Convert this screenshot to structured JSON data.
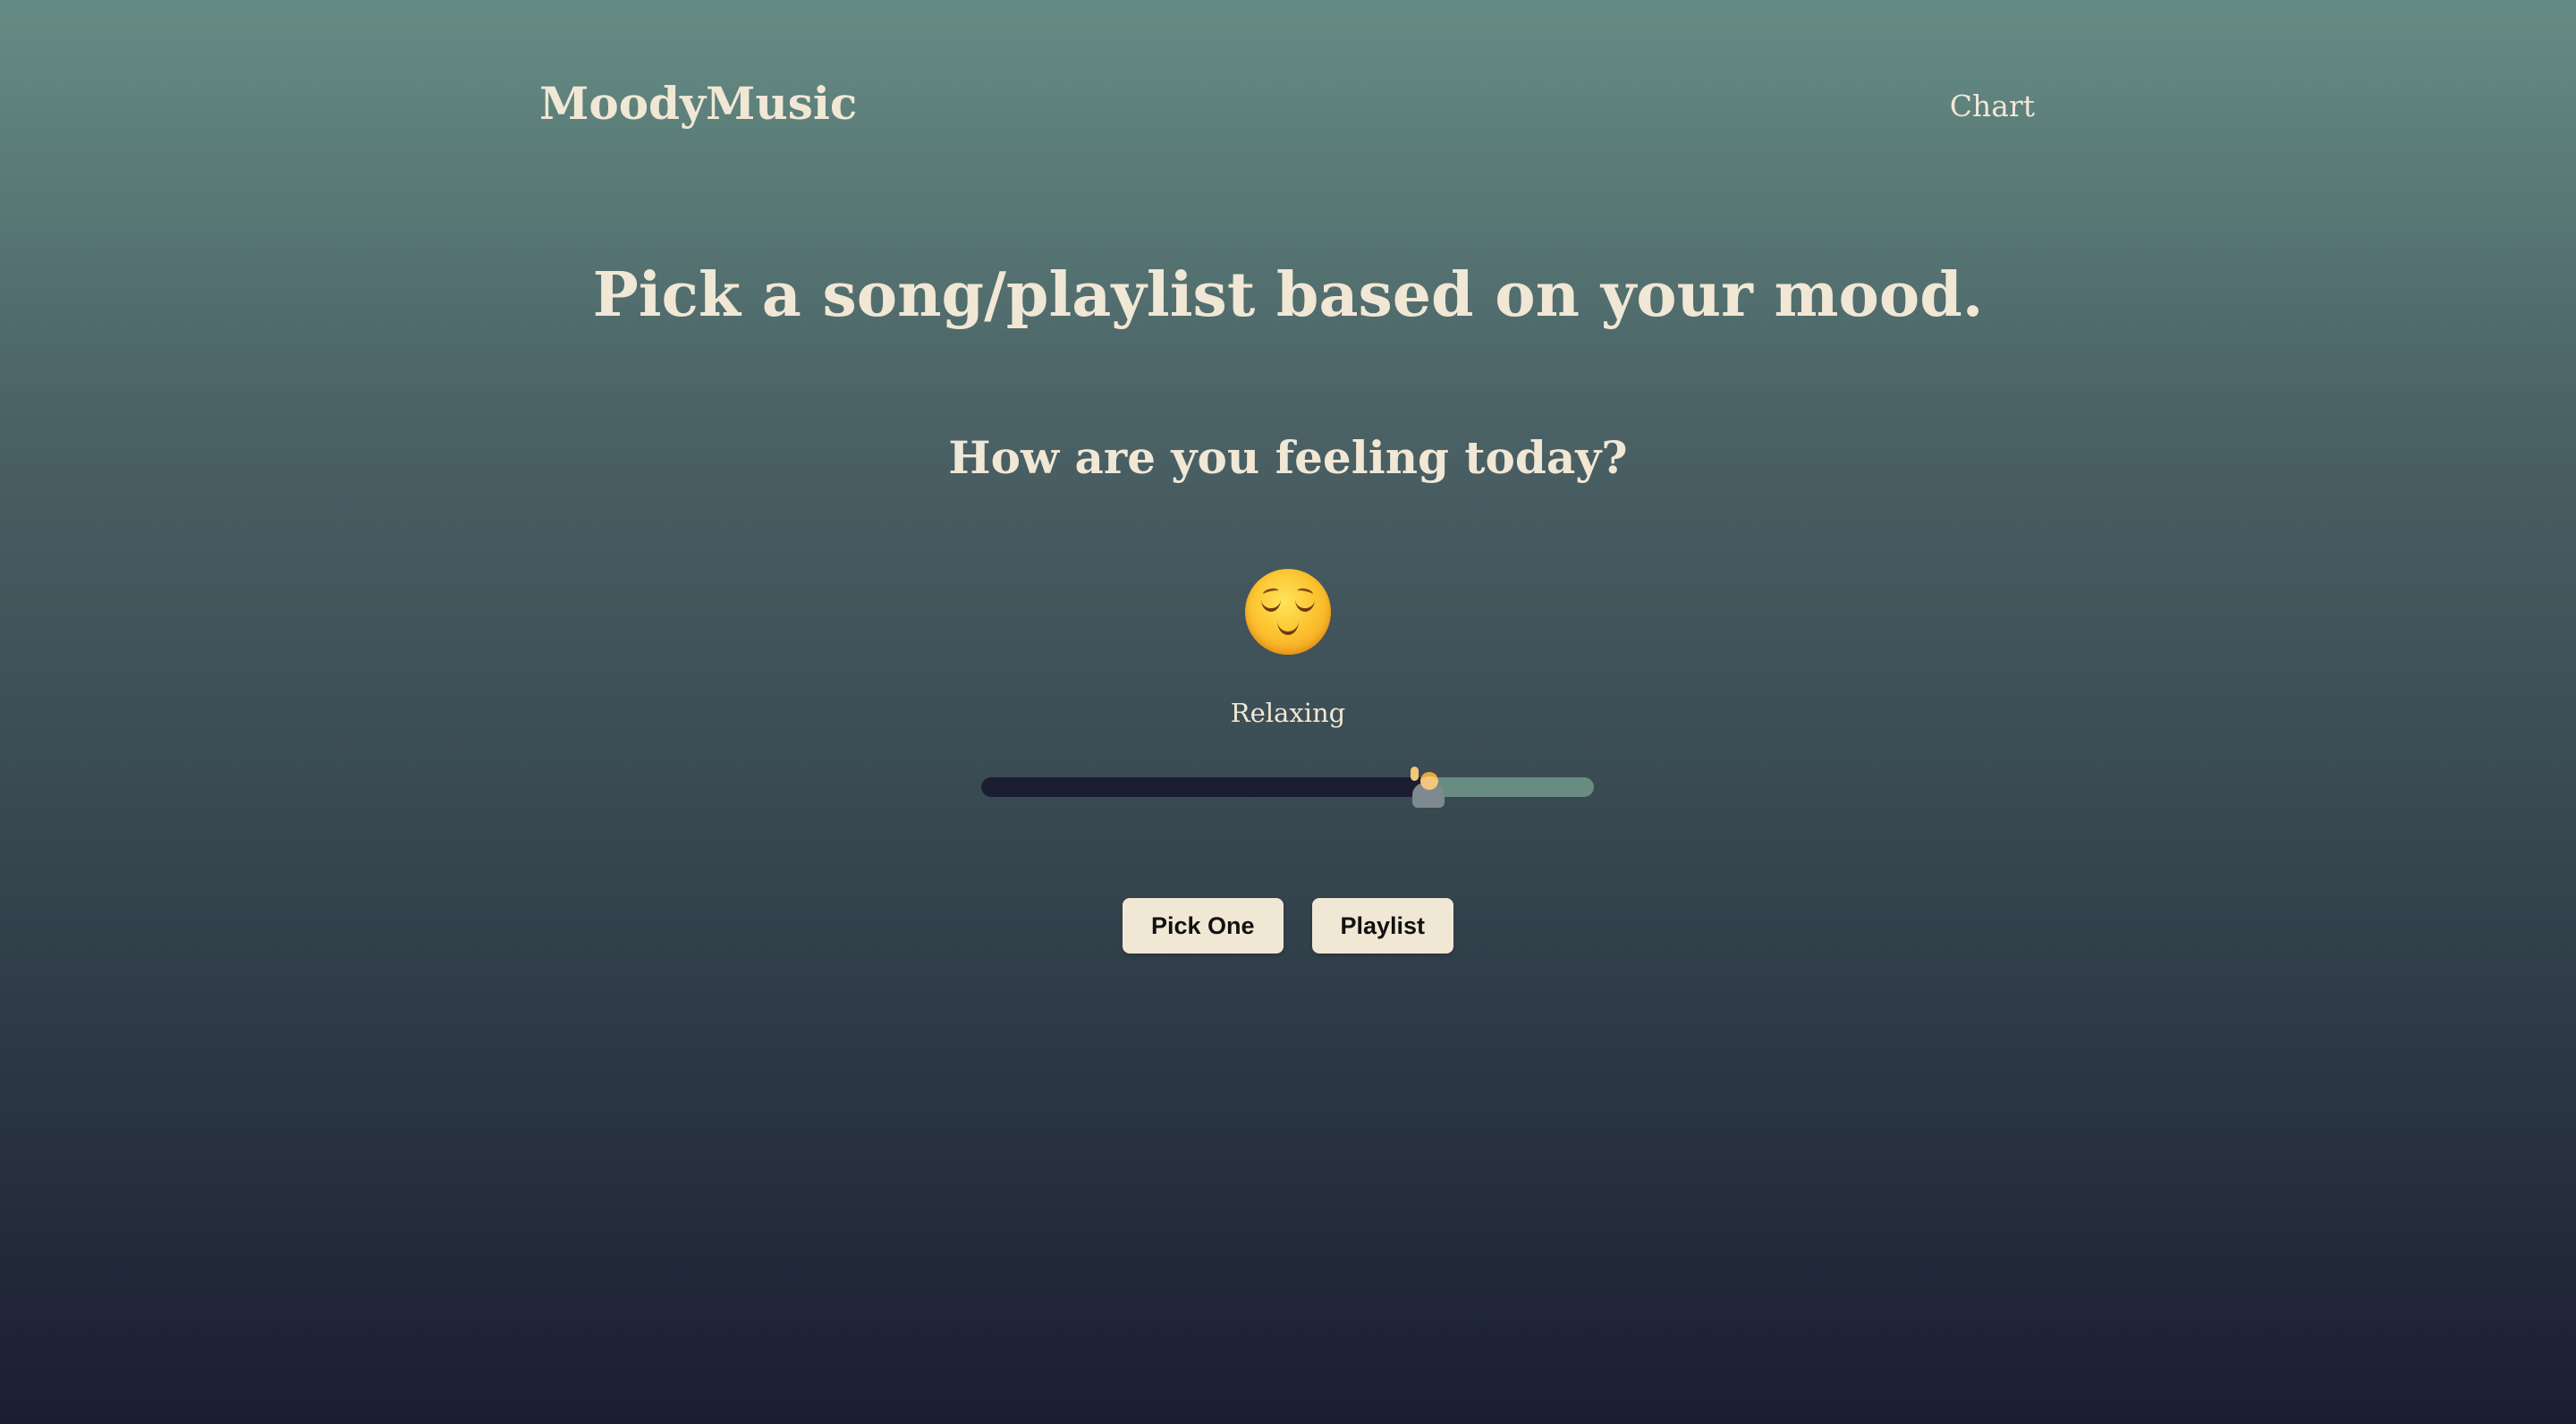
{
  "header": {
    "logo": "MoodyMusic",
    "nav_link": "Chart"
  },
  "main": {
    "headline": "Pick a song/playlist based on your mood.",
    "question": "How are you feeling today?",
    "mood": {
      "emoji_icon": "relieved-face-icon",
      "label": "Relaxing"
    },
    "slider": {
      "value_fraction": 0.73,
      "thumb_icon": "person-getting-massage-icon",
      "filled_color": "#1b1e31",
      "track_color": "#688b82"
    },
    "buttons": {
      "pick_one": "Pick One",
      "playlist": "Playlist"
    }
  },
  "colors": {
    "text": "#f1e7d5",
    "button_bg": "#f1e7d5",
    "gradient_top": "#658c84",
    "gradient_bottom": "#1a1e31"
  }
}
